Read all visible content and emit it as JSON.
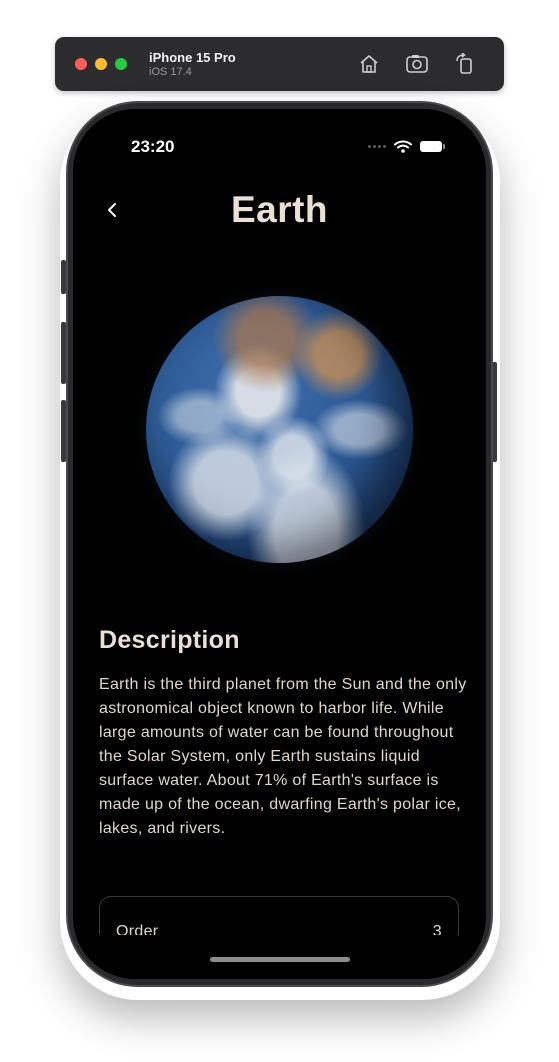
{
  "simulator": {
    "device_name": "iPhone 15 Pro",
    "os_version": "iOS 17.4",
    "icons": [
      "home-icon",
      "screenshot-icon",
      "rotate-icon"
    ]
  },
  "status_bar": {
    "time": "23:20",
    "icons": [
      "signal-icon",
      "wifi-icon",
      "battery-icon"
    ]
  },
  "nav": {
    "back_icon": "chevron-left-icon",
    "title": "Earth"
  },
  "planet": {
    "image_icon": "earth-image"
  },
  "description": {
    "heading": "Description",
    "text": "Earth is the third planet from the Sun and the only astronomical object known to harbor life. While large amounts of water can be found throughout the Solar System, only Earth sustains liquid surface water. About 71% of Earth's surface is made up of the ocean, dwarfing Earth's polar ice, lakes, and rivers."
  },
  "info": {
    "rows": [
      {
        "label": "Order",
        "value": "3"
      }
    ]
  },
  "colors": {
    "screen_bg": "#000000",
    "title_text": "#ebe0d4",
    "body_text": "#e0d6cb",
    "toolbar_bg": "#2c2c2e"
  }
}
